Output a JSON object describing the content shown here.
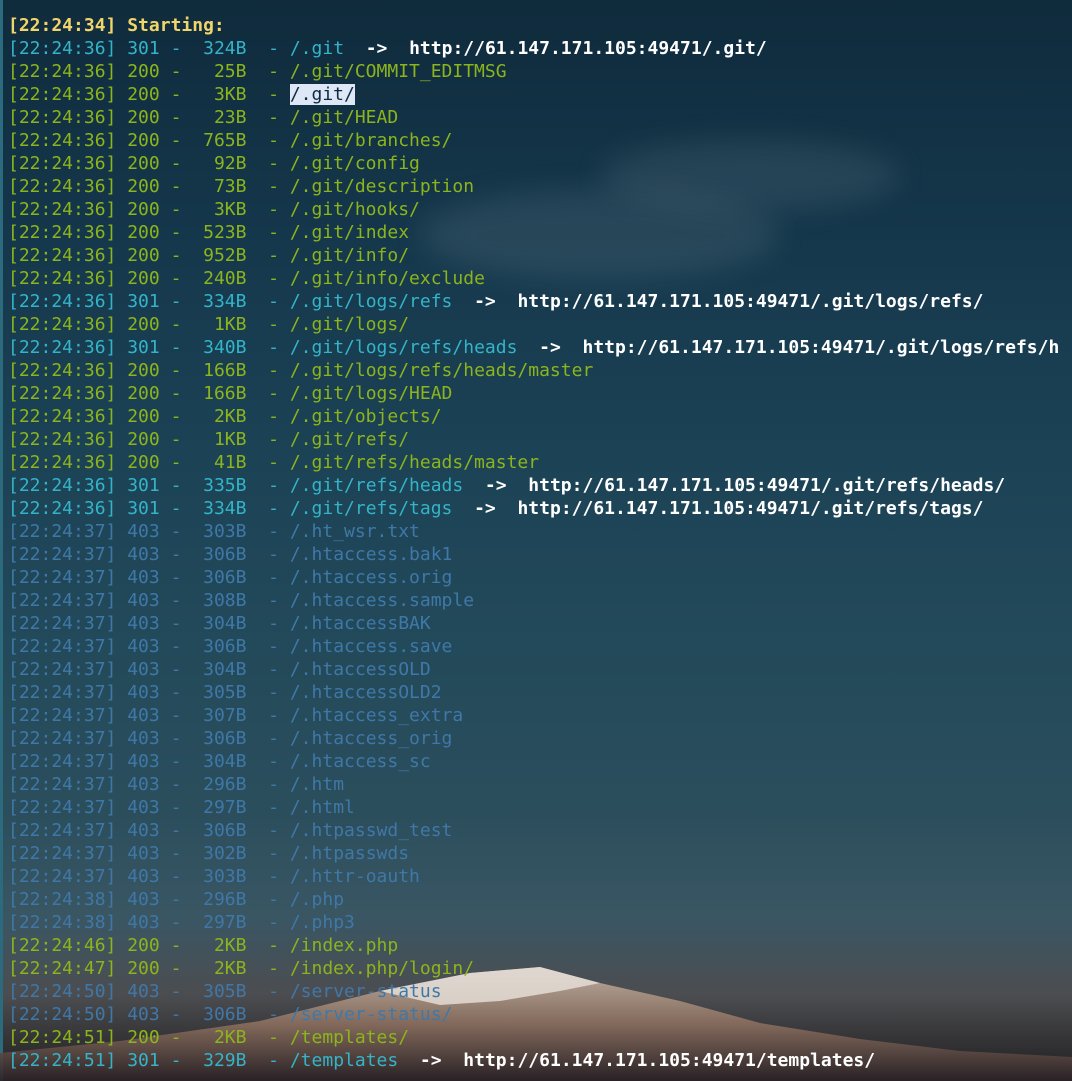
{
  "header": {
    "time": "[22:24:34]",
    "label": "Starting:"
  },
  "lines": [
    {
      "time": "[22:24:36]",
      "status": "301",
      "size": "324B",
      "path": "/.git",
      "redirect": "http://61.147.171.105:49471/.git/",
      "color": "teal"
    },
    {
      "time": "[22:24:36]",
      "status": "200",
      "size": "25B",
      "path": "/.git/COMMIT_EDITMSG",
      "redirect": "",
      "color": "green"
    },
    {
      "time": "[22:24:36]",
      "status": "200",
      "size": "3KB",
      "path": "/.git/",
      "redirect": "",
      "color": "green",
      "selected": true
    },
    {
      "time": "[22:24:36]",
      "status": "200",
      "size": "23B",
      "path": "/.git/HEAD",
      "redirect": "",
      "color": "green"
    },
    {
      "time": "[22:24:36]",
      "status": "200",
      "size": "765B",
      "path": "/.git/branches/",
      "redirect": "",
      "color": "green"
    },
    {
      "time": "[22:24:36]",
      "status": "200",
      "size": "92B",
      "path": "/.git/config",
      "redirect": "",
      "color": "green"
    },
    {
      "time": "[22:24:36]",
      "status": "200",
      "size": "73B",
      "path": "/.git/description",
      "redirect": "",
      "color": "green"
    },
    {
      "time": "[22:24:36]",
      "status": "200",
      "size": "3KB",
      "path": "/.git/hooks/",
      "redirect": "",
      "color": "green"
    },
    {
      "time": "[22:24:36]",
      "status": "200",
      "size": "523B",
      "path": "/.git/index",
      "redirect": "",
      "color": "green"
    },
    {
      "time": "[22:24:36]",
      "status": "200",
      "size": "952B",
      "path": "/.git/info/",
      "redirect": "",
      "color": "green"
    },
    {
      "time": "[22:24:36]",
      "status": "200",
      "size": "240B",
      "path": "/.git/info/exclude",
      "redirect": "",
      "color": "green"
    },
    {
      "time": "[22:24:36]",
      "status": "301",
      "size": "334B",
      "path": "/.git/logs/refs",
      "redirect": "http://61.147.171.105:49471/.git/logs/refs/",
      "color": "teal"
    },
    {
      "time": "[22:24:36]",
      "status": "200",
      "size": "1KB",
      "path": "/.git/logs/",
      "redirect": "",
      "color": "green"
    },
    {
      "time": "[22:24:36]",
      "status": "301",
      "size": "340B",
      "path": "/.git/logs/refs/heads",
      "redirect": "http://61.147.171.105:49471/.git/logs/refs/h",
      "color": "teal"
    },
    {
      "time": "[22:24:36]",
      "status": "200",
      "size": "166B",
      "path": "/.git/logs/refs/heads/master",
      "redirect": "",
      "color": "green"
    },
    {
      "time": "[22:24:36]",
      "status": "200",
      "size": "166B",
      "path": "/.git/logs/HEAD",
      "redirect": "",
      "color": "green"
    },
    {
      "time": "[22:24:36]",
      "status": "200",
      "size": "2KB",
      "path": "/.git/objects/",
      "redirect": "",
      "color": "green"
    },
    {
      "time": "[22:24:36]",
      "status": "200",
      "size": "1KB",
      "path": "/.git/refs/",
      "redirect": "",
      "color": "green"
    },
    {
      "time": "[22:24:36]",
      "status": "200",
      "size": "41B",
      "path": "/.git/refs/heads/master",
      "redirect": "",
      "color": "green"
    },
    {
      "time": "[22:24:36]",
      "status": "301",
      "size": "335B",
      "path": "/.git/refs/heads",
      "redirect": "http://61.147.171.105:49471/.git/refs/heads/",
      "color": "teal"
    },
    {
      "time": "[22:24:36]",
      "status": "301",
      "size": "334B",
      "path": "/.git/refs/tags",
      "redirect": "http://61.147.171.105:49471/.git/refs/tags/",
      "color": "teal"
    },
    {
      "time": "[22:24:37]",
      "status": "403",
      "size": "303B",
      "path": "/.ht_wsr.txt",
      "redirect": "",
      "color": "blue"
    },
    {
      "time": "[22:24:37]",
      "status": "403",
      "size": "306B",
      "path": "/.htaccess.bak1",
      "redirect": "",
      "color": "blue"
    },
    {
      "time": "[22:24:37]",
      "status": "403",
      "size": "306B",
      "path": "/.htaccess.orig",
      "redirect": "",
      "color": "blue"
    },
    {
      "time": "[22:24:37]",
      "status": "403",
      "size": "308B",
      "path": "/.htaccess.sample",
      "redirect": "",
      "color": "blue"
    },
    {
      "time": "[22:24:37]",
      "status": "403",
      "size": "304B",
      "path": "/.htaccessBAK",
      "redirect": "",
      "color": "blue"
    },
    {
      "time": "[22:24:37]",
      "status": "403",
      "size": "306B",
      "path": "/.htaccess.save",
      "redirect": "",
      "color": "blue"
    },
    {
      "time": "[22:24:37]",
      "status": "403",
      "size": "304B",
      "path": "/.htaccessOLD",
      "redirect": "",
      "color": "blue"
    },
    {
      "time": "[22:24:37]",
      "status": "403",
      "size": "305B",
      "path": "/.htaccessOLD2",
      "redirect": "",
      "color": "blue"
    },
    {
      "time": "[22:24:37]",
      "status": "403",
      "size": "307B",
      "path": "/.htaccess_extra",
      "redirect": "",
      "color": "blue"
    },
    {
      "time": "[22:24:37]",
      "status": "403",
      "size": "306B",
      "path": "/.htaccess_orig",
      "redirect": "",
      "color": "blue"
    },
    {
      "time": "[22:24:37]",
      "status": "403",
      "size": "304B",
      "path": "/.htaccess_sc",
      "redirect": "",
      "color": "blue"
    },
    {
      "time": "[22:24:37]",
      "status": "403",
      "size": "296B",
      "path": "/.htm",
      "redirect": "",
      "color": "blue"
    },
    {
      "time": "[22:24:37]",
      "status": "403",
      "size": "297B",
      "path": "/.html",
      "redirect": "",
      "color": "blue"
    },
    {
      "time": "[22:24:37]",
      "status": "403",
      "size": "306B",
      "path": "/.htpasswd_test",
      "redirect": "",
      "color": "blue"
    },
    {
      "time": "[22:24:37]",
      "status": "403",
      "size": "302B",
      "path": "/.htpasswds",
      "redirect": "",
      "color": "blue"
    },
    {
      "time": "[22:24:37]",
      "status": "403",
      "size": "303B",
      "path": "/.httr-oauth",
      "redirect": "",
      "color": "blue"
    },
    {
      "time": "[22:24:38]",
      "status": "403",
      "size": "296B",
      "path": "/.php",
      "redirect": "",
      "color": "blue"
    },
    {
      "time": "[22:24:38]",
      "status": "403",
      "size": "297B",
      "path": "/.php3",
      "redirect": "",
      "color": "blue"
    },
    {
      "time": "[22:24:46]",
      "status": "200",
      "size": "2KB",
      "path": "/index.php",
      "redirect": "",
      "color": "green"
    },
    {
      "time": "[22:24:47]",
      "status": "200",
      "size": "2KB",
      "path": "/index.php/login/",
      "redirect": "",
      "color": "green"
    },
    {
      "time": "[22:24:50]",
      "status": "403",
      "size": "305B",
      "path": "/server-status",
      "redirect": "",
      "color": "blue"
    },
    {
      "time": "[22:24:50]",
      "status": "403",
      "size": "306B",
      "path": "/server-status/",
      "redirect": "",
      "color": "blue"
    },
    {
      "time": "[22:24:51]",
      "status": "200",
      "size": "2KB",
      "path": "/templates/",
      "redirect": "",
      "color": "green"
    },
    {
      "time": "[22:24:51]",
      "status": "301",
      "size": "329B",
      "path": "/templates",
      "redirect": "http://61.147.171.105:49471/templates/",
      "color": "teal"
    }
  ],
  "arrow": "->",
  "dash": "-",
  "colors": {
    "teal": "#34b4c8",
    "green": "#8cb41c",
    "blue": "#3f78a8",
    "yellow": "#f0d56b",
    "white": "#ffffff"
  }
}
